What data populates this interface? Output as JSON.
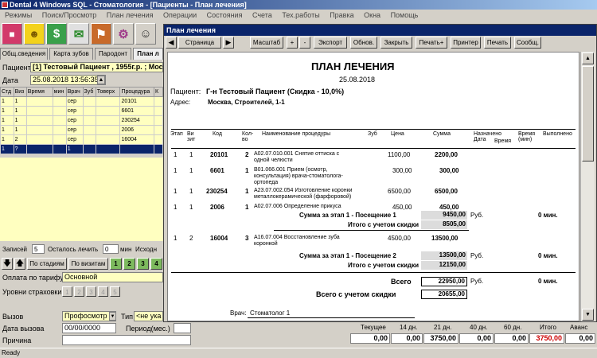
{
  "window": {
    "title": "Dental 4 Windows SQL - Стоматология - [Пациенты - План лечения]"
  },
  "menu": [
    "Режимы",
    "Поиск/Просмотр",
    "План лечения",
    "Операции",
    "Состояния",
    "Счета",
    "Тех.работы",
    "Правка",
    "Окна",
    "Помощь"
  ],
  "toolbar_icons": [
    "tooth-icon",
    "smiley-icon",
    "dollar-icon",
    "mail-icon",
    "shield-icon",
    "gears-icon",
    "doctor-icon"
  ],
  "colors": {
    "title_blue": "#0a246a",
    "yellow_field": "#ffffc0",
    "green_button": "#7dba5e",
    "selection": "#0a246a",
    "red_value": "#cc0000"
  },
  "tabs": [
    "Общ.сведения",
    "Карта зубов",
    "Пародонт",
    "План л"
  ],
  "patient": {
    "label": "Пациент",
    "value": "[1] Тестовый Пациент , 1955г.р. ; Моска"
  },
  "date": {
    "label": "Дата",
    "value": "25.08.2018 13:56:35"
  },
  "grid": {
    "headers": [
      "Стд",
      "Виз",
      "Время",
      "мин",
      "Врач",
      "Зуб",
      "Товерх",
      "Процедура",
      "К"
    ],
    "rows": [
      [
        "1",
        "1",
        "",
        "",
        "сер",
        "",
        "",
        "20101",
        ""
      ],
      [
        "1",
        "1",
        "",
        "",
        "сер",
        "",
        "",
        "6601",
        ""
      ],
      [
        "1",
        "1",
        "",
        "",
        "сер",
        "",
        "",
        "230254",
        ""
      ],
      [
        "1",
        "1",
        "",
        "",
        "сер",
        "",
        "",
        "2006",
        ""
      ],
      [
        "1",
        "2",
        "",
        "",
        "сер",
        "",
        "",
        "16004",
        ""
      ],
      [
        "1",
        "?",
        "",
        "",
        "1",
        "",
        "",
        "",
        ""
      ]
    ]
  },
  "counts": {
    "records_label": "Записей",
    "records": "5",
    "left_label": "Осталось лечить",
    "left": "0",
    "min_label": "мин",
    "outcome_label": "Исходн"
  },
  "buttons": {
    "by_stages": "По стадиям",
    "by_visits": "По визитам",
    "nums": [
      "1",
      "2",
      "3",
      "4"
    ]
  },
  "payment": {
    "label": "Оплата по тарифу",
    "value": "Основной"
  },
  "insurance": {
    "label": "Уровни страховки",
    "nums": [
      "1",
      "2",
      "3",
      "4",
      "5"
    ]
  },
  "call": {
    "label": "Вызов",
    "value": "Профосмотр",
    "type_label": "Тип",
    "type_value": "<не ука"
  },
  "call_date": {
    "label": "Дата вызова",
    "value": "00/00/0000",
    "period_label": "Период(мес.)"
  },
  "reason": {
    "label": "Причина"
  },
  "docwin": {
    "title": "План лечения",
    "page_label": "Страница",
    "tools": [
      "Масштаб",
      "+",
      "-",
      "Экспорт",
      "Обнов.",
      "Закрыть",
      "Печать+",
      "Принтер",
      "Печать",
      "Сообщ."
    ]
  },
  "report": {
    "heading": "ПЛАН ЛЕЧЕНИЯ",
    "date": "25.08.2018",
    "patient_label": "Пациент:",
    "patient": "Г-н Тестовый Пациент (Скидка - 10,0%)",
    "address_label": "Адрес:",
    "address": "Москва, Строителей, 1-1",
    "columns": [
      "Этап",
      "Ви зит",
      "Код",
      "Кол- во",
      "Наименование процедуры",
      "Зуб",
      "Цена",
      "Сумма",
      "Назначено Дата",
      "Время",
      "Время (мин)",
      "Выполнено"
    ],
    "rows": [
      {
        "stage": "1",
        "visit": "1",
        "code": "20101",
        "qty": "2",
        "name": "A02.07.010.001 Снятие оттиска с одной челюсти",
        "price": "1100,00",
        "sum": "2200,00"
      },
      {
        "stage": "1",
        "visit": "1",
        "code": "6601",
        "qty": "1",
        "name": "B01.066.001 Прием (осмотр, консультация) врача-стоматолога-ортопеда",
        "price": "300,00",
        "sum": "300,00"
      },
      {
        "stage": "1",
        "visit": "1",
        "code": "230254",
        "qty": "1",
        "name": "A23.07.002.054 Изготовление коронки металлокерамической (фарфоровой)",
        "price": "6500,00",
        "sum": "6500,00"
      },
      {
        "stage": "1",
        "visit": "1",
        "code": "2006",
        "qty": "1",
        "name": "A02.07.006 Определение прикуса",
        "price": "450,00",
        "sum": "450,00"
      },
      {
        "stage": "1",
        "visit": "2",
        "code": "16004",
        "qty": "3",
        "name": "A16.07.004 Восстановление зуба коронкой",
        "price": "4500,00",
        "sum": "13500,00"
      }
    ],
    "visit1_total_label": "Сумма за этап   1    - Посещение 1",
    "visit1_total": "9450,00",
    "visit1_disc_label": "Итого с учетом скидки",
    "visit1_disc": "8505,00",
    "visit2_total_label": "Сумма за этап   1    - Посещение 2",
    "visit2_total": "13500,00",
    "visit2_disc_label": "Итого с учетом скидки",
    "visit2_disc": "12150,00",
    "currency": "Руб.",
    "zero_min": "0 мин.",
    "total_label": "Всего",
    "total": "22950,00",
    "total_disc_label": "Всего с учетом скидки",
    "total_disc": "20655,00",
    "doctor_label": "Врач:",
    "doctor": "Стоматолог 1"
  },
  "summary": {
    "labels": [
      "Текущее",
      "14 дн.",
      "21 дн.",
      "40 дн.",
      "60 дн.",
      "Итого",
      "Аванс"
    ],
    "values": [
      "0,00",
      "0,00",
      "3750,00",
      "0,00",
      "0,00",
      "3750,00",
      "0,00"
    ]
  },
  "status": "Ready"
}
